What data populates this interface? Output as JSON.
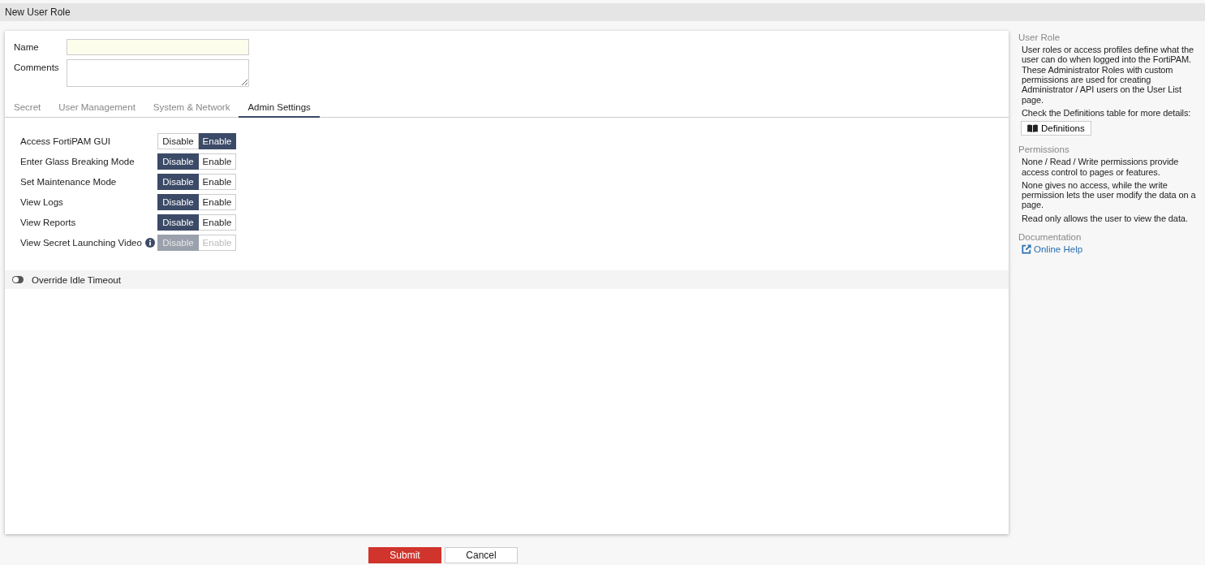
{
  "window": {
    "title": "New User Role"
  },
  "form": {
    "fields": [
      {
        "label": "Name",
        "kind": "text",
        "required": true
      },
      {
        "label": "Comments",
        "kind": "textarea",
        "required": false
      }
    ]
  },
  "tabs": [
    {
      "label": "Secret",
      "selected": false
    },
    {
      "label": "User Management",
      "selected": false
    },
    {
      "label": "System & Network",
      "selected": false
    },
    {
      "label": "Admin Settings",
      "selected": true
    }
  ],
  "settings": [
    {
      "label": "Access FortiPAM GUI",
      "options": [
        {
          "label": "Disable",
          "selected": false
        },
        {
          "label": "Enable",
          "selected": true
        }
      ],
      "disabled": false,
      "info": false
    },
    {
      "label": "Enter Glass Breaking Mode",
      "options": [
        {
          "label": "Disable",
          "selected": true
        },
        {
          "label": "Enable",
          "selected": false
        }
      ],
      "disabled": false,
      "info": false
    },
    {
      "label": "Set Maintenance Mode",
      "options": [
        {
          "label": "Disable",
          "selected": true
        },
        {
          "label": "Enable",
          "selected": false
        }
      ],
      "disabled": false,
      "info": false
    },
    {
      "label": "View Logs",
      "options": [
        {
          "label": "Disable",
          "selected": true
        },
        {
          "label": "Enable",
          "selected": false
        }
      ],
      "disabled": false,
      "info": false
    },
    {
      "label": "View Reports",
      "options": [
        {
          "label": "Disable",
          "selected": true
        },
        {
          "label": "Enable",
          "selected": false
        }
      ],
      "disabled": false,
      "info": false
    },
    {
      "label": "View Secret Launching Video",
      "options": [
        {
          "label": "Disable",
          "selected": true
        },
        {
          "label": "Enable",
          "selected": false
        }
      ],
      "disabled": true,
      "info": true
    }
  ],
  "idle_timeout": {
    "label": "Override Idle Timeout",
    "on": false
  },
  "sidebar": {
    "sections": [
      {
        "heading": "User Role",
        "paragraphs": [
          "User roles or access profiles define what the user can do when logged into the FortiPAM. These Administrator Roles with custom permissions are used for creating Administrator / API users on the User List page.",
          "Check the Definitions table for more details:"
        ],
        "button": "Definitions"
      },
      {
        "heading": "Permissions",
        "paragraphs": [
          "None / Read / Write permissions provide access control to pages or features.",
          "None gives no access, while the write permission lets the user modify the data on a page.",
          "Read only allows the user to view the data."
        ]
      },
      {
        "heading": "Documentation",
        "link": "Online Help"
      }
    ]
  },
  "buttons": [
    {
      "label": "Submit",
      "kind": "primary"
    },
    {
      "label": "Cancel",
      "kind": "secondary"
    }
  ]
}
